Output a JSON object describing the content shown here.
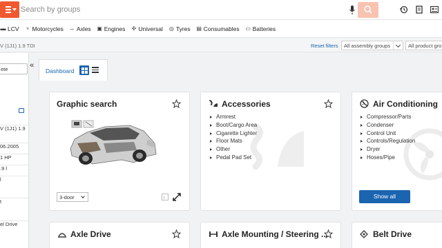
{
  "search": {
    "placeholder": "Search by groups"
  },
  "categories": [
    {
      "label": "LCV",
      "icon": "truck-icon"
    },
    {
      "label": "Motorcycles",
      "icon": "motorcycle-icon"
    },
    {
      "label": "Axles",
      "icon": "axle-icon"
    },
    {
      "label": "Engines",
      "icon": "engine-icon"
    },
    {
      "label": "Universal",
      "icon": "universal-icon"
    },
    {
      "label": "Tyres",
      "icon": "tyre-icon"
    },
    {
      "label": "Consumables",
      "icon": "consumables-icon"
    },
    {
      "label": "Batteries",
      "icon": "battery-icon"
    }
  ],
  "filters": {
    "vehicle_name": "V (1J1) 1.9 TDI",
    "reset_label": "Reset filters",
    "assembly_groups": "All assembly groups",
    "product_groups": "All product gro"
  },
  "left_panel": {
    "button_label": "ete",
    "rows": [
      "V (1J1) 1.9",
      "06.2005",
      "1 HP",
      ".9 l",
      "l",
      "t",
      "el Drive"
    ]
  },
  "dashboard": {
    "tab_label": "Dashboard"
  },
  "cards": {
    "graphic_search": {
      "title": "Graphic search",
      "door_select": "3-door"
    },
    "accessories": {
      "title": "Accessories",
      "items": [
        "Armrest",
        "Boot/Cargo Area",
        "Cigarette Lighter",
        "Floor Mats",
        "Other",
        "Pedal Pad Set"
      ]
    },
    "air_conditioning": {
      "title": "Air Conditioning",
      "items": [
        "Compressor/Parts",
        "Condenser",
        "Control Unit",
        "Controls/Regulation",
        "Dryer",
        "Hoses/Pipe"
      ],
      "show_all": "Show all"
    },
    "axle_drive": {
      "title": "Axle Drive"
    },
    "axle_mounting": {
      "title": "Axle Mounting / Steering ..."
    },
    "belt_drive": {
      "title": "Belt Drive"
    }
  },
  "colors": {
    "brand_orange": "#f0592f",
    "link_blue": "#1a64b0",
    "search_btn": "#f8c3b1"
  }
}
